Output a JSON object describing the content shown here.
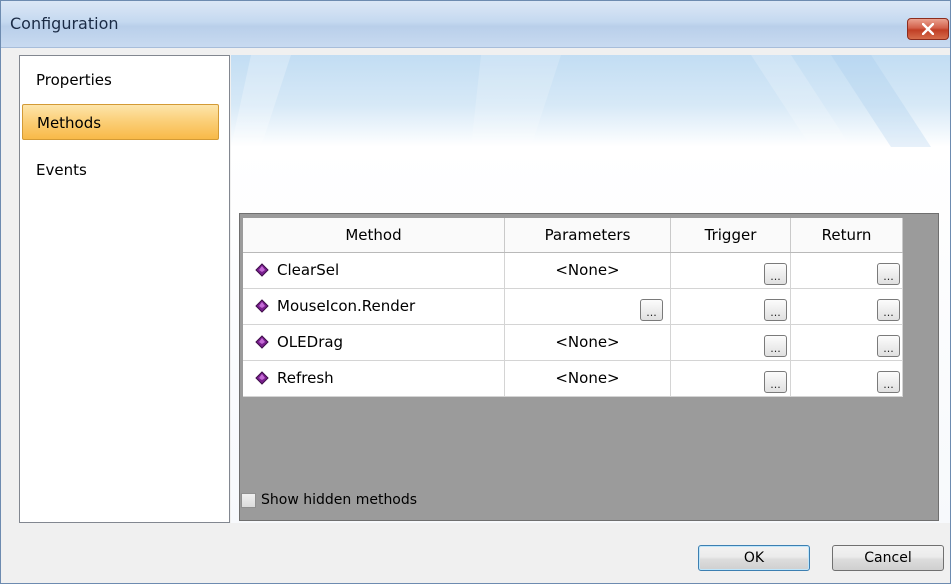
{
  "window": {
    "title": "Configuration"
  },
  "sidebar": {
    "items": [
      {
        "label": "Properties",
        "selected": false
      },
      {
        "label": "Methods",
        "selected": true
      },
      {
        "label": "Events",
        "selected": false
      }
    ]
  },
  "grid": {
    "columns": [
      "Method",
      "Parameters",
      "Trigger",
      "Return"
    ],
    "rows": [
      {
        "method": "ClearSel",
        "parameters": "<None>",
        "trigger_button": "...",
        "return_button": "..."
      },
      {
        "method": "MouseIcon.Render",
        "parameters": "",
        "parameters_button": "...",
        "trigger_button": "...",
        "return_button": "..."
      },
      {
        "method": "OLEDrag",
        "parameters": "<None>",
        "trigger_button": "...",
        "return_button": "..."
      },
      {
        "method": "Refresh",
        "parameters": "<None>",
        "trigger_button": "...",
        "return_button": "..."
      }
    ]
  },
  "options": {
    "show_hidden_label": "Show hidden methods",
    "show_hidden_checked": false
  },
  "footer": {
    "ok_label": "OK",
    "cancel_label": "Cancel"
  },
  "colors": {
    "selected_item": "#fbd07a",
    "grid_background": "#9b9b9b",
    "close_button": "#c13e25",
    "method_icon": "#7a1f8f"
  }
}
